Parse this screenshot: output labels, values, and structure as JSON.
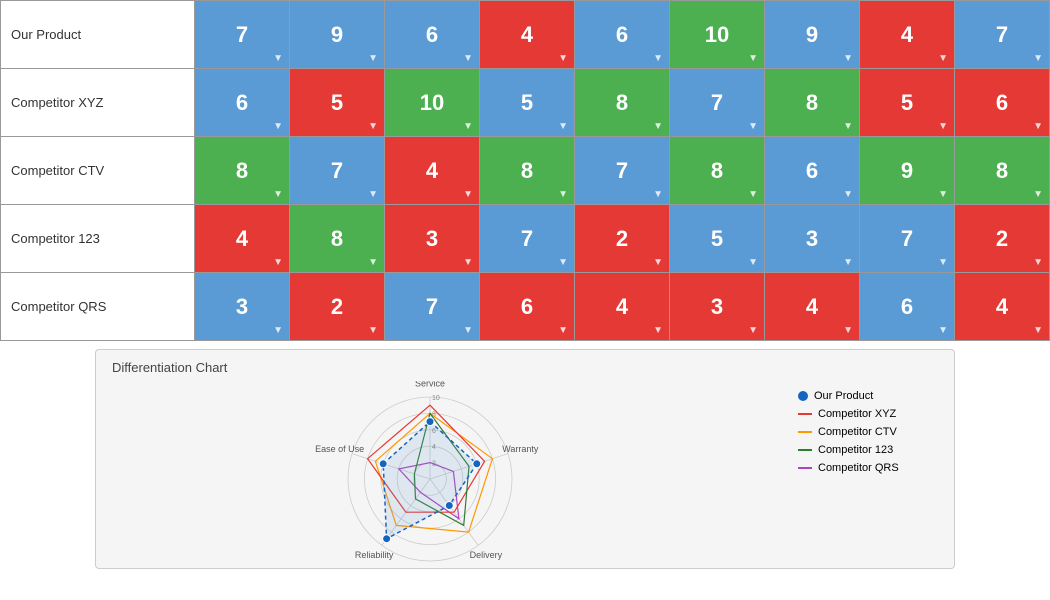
{
  "rows": [
    {
      "label": "Our Product",
      "values": [
        7,
        9,
        6,
        4,
        6,
        10,
        9,
        4,
        7
      ],
      "colors": [
        "blue",
        "blue",
        "blue",
        "red",
        "blue",
        "green",
        "blue",
        "red",
        "blue"
      ]
    },
    {
      "label": "Competitor XYZ",
      "values": [
        6,
        5,
        10,
        5,
        8,
        7,
        8,
        5,
        6
      ],
      "colors": [
        "blue",
        "red",
        "green",
        "blue",
        "green",
        "blue",
        "green",
        "red",
        "red"
      ]
    },
    {
      "label": "Competitor CTV",
      "values": [
        8,
        7,
        4,
        8,
        7,
        8,
        6,
        9,
        8
      ],
      "colors": [
        "green",
        "blue",
        "red",
        "green",
        "blue",
        "green",
        "blue",
        "green",
        "green"
      ]
    },
    {
      "label": "Competitor 123",
      "values": [
        4,
        8,
        3,
        7,
        2,
        5,
        3,
        7,
        2
      ],
      "colors": [
        "red",
        "green",
        "red",
        "blue",
        "red",
        "blue",
        "blue",
        "blue",
        "red"
      ]
    },
    {
      "label": "Competitor QRS",
      "values": [
        3,
        2,
        7,
        6,
        4,
        3,
        4,
        6,
        4
      ],
      "colors": [
        "blue",
        "red",
        "blue",
        "red",
        "red",
        "red",
        "red",
        "blue",
        "red"
      ]
    }
  ],
  "chart": {
    "title": "Differentiation Chart",
    "axes": [
      "Service",
      "Warranty",
      "Delivery",
      "Reliability",
      "Ease of Use"
    ],
    "legend": [
      {
        "label": "Our Product",
        "color": "#1565c0",
        "type": "dot"
      },
      {
        "label": "Competitor XYZ",
        "color": "#e53935",
        "type": "line"
      },
      {
        "label": "Competitor CTV",
        "color": "#ff9800",
        "type": "line"
      },
      {
        "label": "Competitor 123",
        "color": "#2e7d32",
        "type": "line"
      },
      {
        "label": "Competitor QRS",
        "color": "#ab47bc",
        "type": "line"
      }
    ],
    "data": {
      "ourProduct": [
        7,
        6,
        4,
        9,
        6
      ],
      "competitorXYZ": [
        9,
        7,
        5,
        5,
        8
      ],
      "competitorCTV": [
        8,
        8,
        8,
        7,
        7
      ],
      "competitor123": [
        8,
        5,
        7,
        3,
        2
      ],
      "competitorQRS": [
        2,
        3,
        6,
        2,
        4
      ]
    }
  }
}
